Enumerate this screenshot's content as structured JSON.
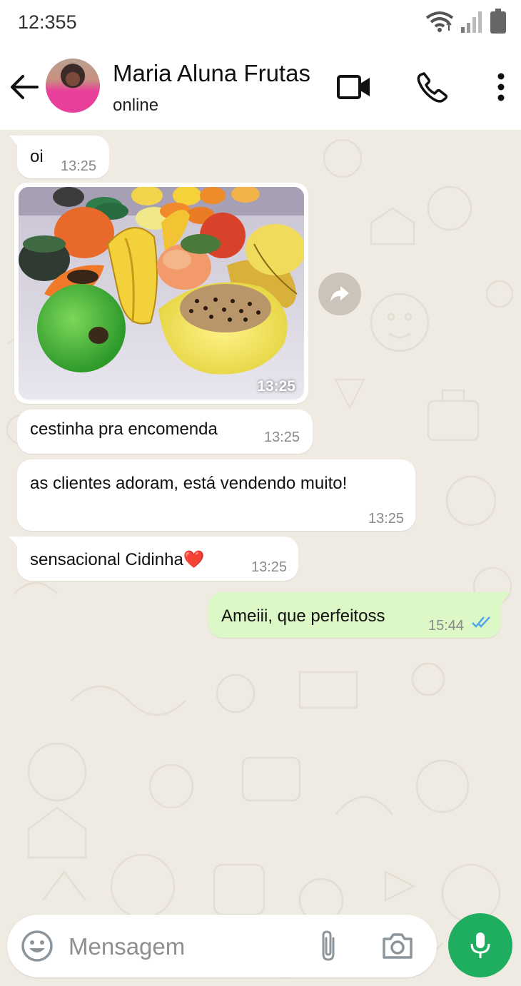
{
  "status_bar": {
    "time": "12:355"
  },
  "header": {
    "contact_name": "Maria Aluna Frutas",
    "contact_status": "online",
    "icons": [
      "back-arrow-icon",
      "video-call-icon",
      "phone-icon",
      "more-vert-icon"
    ]
  },
  "messages": [
    {
      "direction": "in",
      "text": "oi",
      "time": "13:25"
    },
    {
      "direction": "in",
      "type": "image",
      "image_description": "fruit",
      "time": "13:25"
    },
    {
      "direction": "in",
      "text": "cestinha pra encomenda",
      "time": "13:25"
    },
    {
      "direction": "in",
      "text": "as clientes adoram, está vendendo muito!",
      "time": "13:25"
    },
    {
      "direction": "in",
      "text": "sensacional Cidinha❤️",
      "time": "13:25"
    },
    {
      "direction": "out",
      "text": "Ameiii, que perfeitoss",
      "time": "15:44",
      "status": "read"
    }
  ],
  "input": {
    "placeholder": "Mensagem"
  },
  "colors": {
    "chat_background": "#efeae2",
    "outgoing_bubble": "#dcf8c6",
    "incoming_bubble": "#ffffff",
    "mic_button": "#1fae5f",
    "read_ticks": "#4fa6ea"
  }
}
